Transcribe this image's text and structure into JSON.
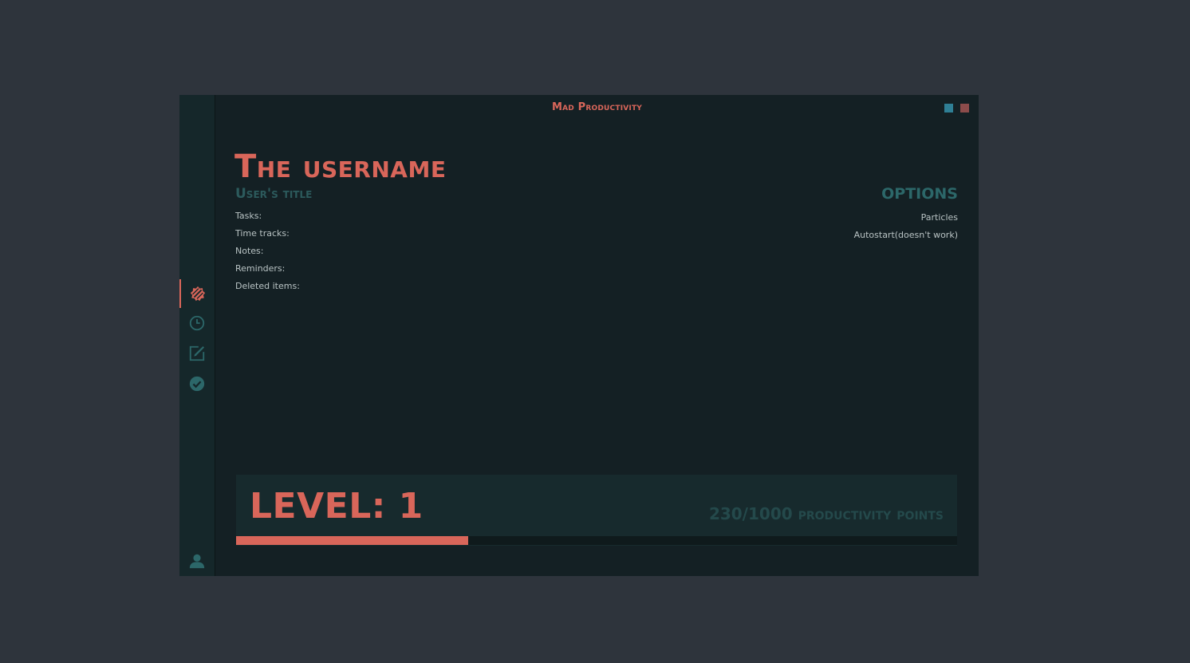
{
  "app": {
    "title": "Mad Productivity"
  },
  "colors": {
    "accent": "#d9665a",
    "muted_teal": "#2c6769",
    "window_bg": "#142024",
    "sidebar_bg": "#15272a",
    "minimize_button": "#2f7f95",
    "close_button": "#8c4c4b"
  },
  "sidebar": {
    "items": [
      {
        "icon": "medal-icon",
        "active": true
      },
      {
        "icon": "clock-icon",
        "active": false
      },
      {
        "icon": "edit-icon",
        "active": false
      },
      {
        "icon": "check-circle-icon",
        "active": false
      }
    ],
    "footer_icon": "user-icon"
  },
  "profile": {
    "username": "The username",
    "title": "User's title",
    "stats": [
      "Tasks:",
      "Time tracks:",
      "Notes:",
      "Reminders:",
      "Deleted items:"
    ]
  },
  "options": {
    "heading": "OPTIONS",
    "items": [
      "Particles",
      "Autostart(doesn't work)"
    ]
  },
  "level": {
    "label": "LEVEL: 1",
    "points_text": "230/1000 productivity points",
    "progress": 0.23
  }
}
